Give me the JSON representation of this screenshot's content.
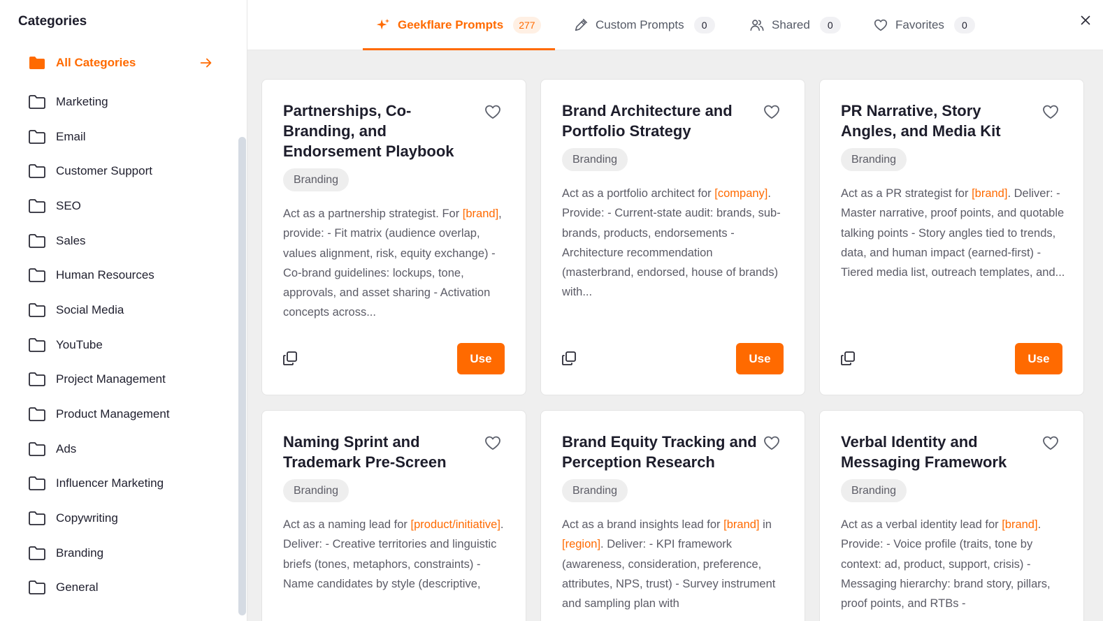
{
  "sidebar": {
    "title": "Categories",
    "items": [
      {
        "label": "All Categories",
        "active": true
      },
      {
        "label": "Marketing"
      },
      {
        "label": "Email"
      },
      {
        "label": "Customer Support"
      },
      {
        "label": "SEO"
      },
      {
        "label": "Sales"
      },
      {
        "label": "Human Resources"
      },
      {
        "label": "Social Media"
      },
      {
        "label": "YouTube"
      },
      {
        "label": "Project Management"
      },
      {
        "label": "Product Management"
      },
      {
        "label": "Ads"
      },
      {
        "label": "Influencer Marketing"
      },
      {
        "label": "Copywriting"
      },
      {
        "label": "Branding"
      },
      {
        "label": "General"
      }
    ]
  },
  "tabs": [
    {
      "label": "Geekflare Prompts",
      "count": "277",
      "icon": "sparkle-icon",
      "active": true
    },
    {
      "label": "Custom Prompts",
      "count": "0",
      "icon": "pen-icon"
    },
    {
      "label": "Shared",
      "count": "0",
      "icon": "users-icon"
    },
    {
      "label": "Favorites",
      "count": "0",
      "icon": "heart-icon"
    }
  ],
  "colors": {
    "accent": "#ff6a00",
    "background": "#efefef"
  },
  "cards": [
    {
      "title": "Partnerships, Co-Branding, and Endorsement Playbook",
      "tag": "Branding",
      "desc": [
        {
          "t": "Act as a partnership strategist. For "
        },
        {
          "t": "[brand]",
          "ph": true
        },
        {
          "t": ", provide: - Fit matrix (audience overlap, values alignment, risk, equity exchange) - Co-brand guidelines: lockups, tone, approvals, and asset sharing - Activation concepts across..."
        }
      ],
      "use_label": "Use"
    },
    {
      "title": "Brand Architecture and Portfolio Strategy",
      "tag": "Branding",
      "desc": [
        {
          "t": "Act as a portfolio architect for "
        },
        {
          "t": "[company]",
          "ph": true
        },
        {
          "t": ". Provide: - Current-state audit: brands, sub-brands, products, endorsements - Architecture recommendation (masterbrand, endorsed, house of brands) with..."
        }
      ],
      "use_label": "Use"
    },
    {
      "title": "PR Narrative, Story Angles, and Media Kit",
      "tag": "Branding",
      "desc": [
        {
          "t": "Act as a PR strategist for "
        },
        {
          "t": "[brand]",
          "ph": true
        },
        {
          "t": ". Deliver: - Master narrative, proof points, and quotable talking points - Story angles tied to trends, data, and human impact (earned-first) - Tiered media list, outreach templates, and..."
        }
      ],
      "use_label": "Use"
    },
    {
      "title": "Naming Sprint and Trademark Pre-Screen",
      "tag": "Branding",
      "desc": [
        {
          "t": "Act as a naming lead for "
        },
        {
          "t": "[product/initiative]",
          "ph": true
        },
        {
          "t": ". Deliver: - Creative territories and linguistic briefs (tones, metaphors, constraints) - Name candidates by style (descriptive,"
        }
      ],
      "use_label": "Use"
    },
    {
      "title": "Brand Equity Tracking and Perception Research",
      "tag": "Branding",
      "desc": [
        {
          "t": "Act as a brand insights lead for "
        },
        {
          "t": "[brand]",
          "ph": true
        },
        {
          "t": " in "
        },
        {
          "t": "[region]",
          "ph": true
        },
        {
          "t": ". Deliver: - KPI framework (awareness, consideration, preference, attributes, NPS, trust) - Survey instrument and sampling plan with"
        }
      ],
      "use_label": "Use"
    },
    {
      "title": "Verbal Identity and Messaging Framework",
      "tag": "Branding",
      "desc": [
        {
          "t": "Act as a verbal identity lead for "
        },
        {
          "t": "[brand]",
          "ph": true
        },
        {
          "t": ". Provide: - Voice profile (traits, tone by context: ad, product, support, crisis) - Messaging hierarchy: brand story, pillars, proof points, and RTBs -"
        }
      ],
      "use_label": "Use"
    }
  ]
}
